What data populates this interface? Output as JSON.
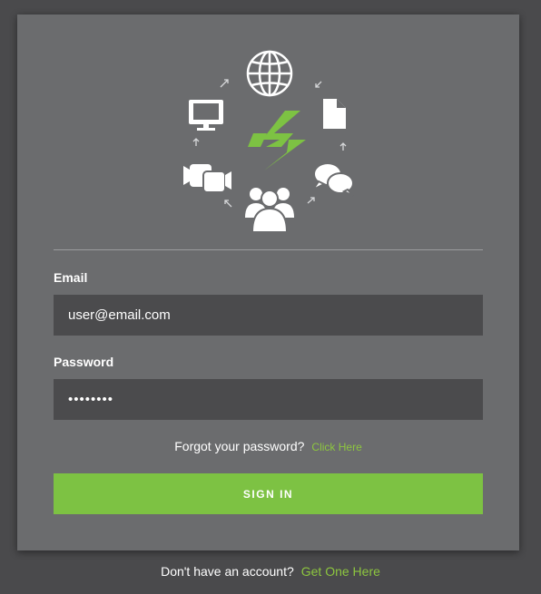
{
  "hero": {
    "icons": [
      "globe-icon",
      "document-icon",
      "chat-bubbles-icon",
      "users-group-icon",
      "video-camera-icon",
      "monitor-icon"
    ],
    "logo_icon": "lightning-logo-icon",
    "accent_color": "#7dc243"
  },
  "form": {
    "email_label": "Email",
    "email_value": "user@email.com",
    "password_label": "Password",
    "password_value": "••••••••",
    "forgot_text": "Forgot your password?",
    "forgot_link": "Click Here",
    "signin_label": "SIGN IN"
  },
  "footer": {
    "text": "Don't have an account?",
    "link": "Get One Here"
  },
  "colors": {
    "page_bg": "#4a4a4c",
    "card_bg": "#6b6c6e",
    "field_bg": "#4b4b4d",
    "accent": "#7dc243",
    "link": "#8dc63f"
  }
}
